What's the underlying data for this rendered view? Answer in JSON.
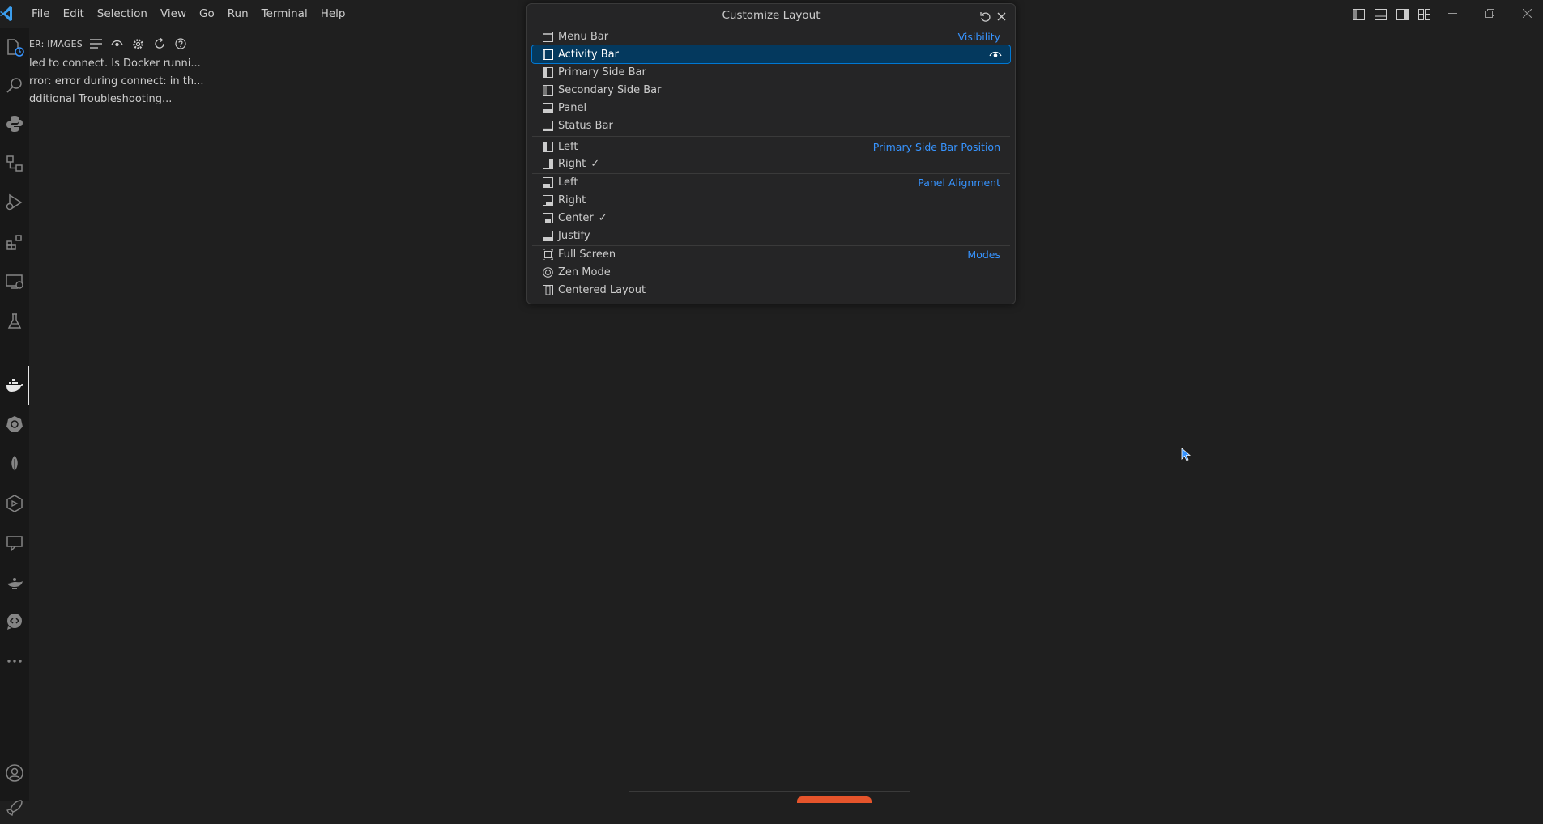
{
  "menu": [
    "File",
    "Edit",
    "Selection",
    "View",
    "Go",
    "Run",
    "Terminal",
    "Help"
  ],
  "sidebar": {
    "title": "ER: IMAGES",
    "lines": [
      "led to connect. Is Docker runni...",
      "rror: error during connect: in th...",
      "dditional Troubleshooting..."
    ]
  },
  "quickpick": {
    "title": "Customize Layout",
    "groups": {
      "visibility": "Visibility",
      "sidebar_position": "Primary Side Bar Position",
      "panel_alignment": "Panel Alignment",
      "modes": "Modes"
    },
    "items": [
      {
        "label": "Menu Bar",
        "checked": ""
      },
      {
        "label": "Activity Bar",
        "checked": ""
      },
      {
        "label": "Primary Side Bar",
        "checked": ""
      },
      {
        "label": "Secondary Side Bar",
        "checked": ""
      },
      {
        "label": "Panel",
        "checked": ""
      },
      {
        "label": "Status Bar",
        "checked": ""
      },
      {
        "label": "Left",
        "checked": ""
      },
      {
        "label": "Right",
        "checked": "✓"
      },
      {
        "label": "Left",
        "checked": ""
      },
      {
        "label": "Right",
        "checked": ""
      },
      {
        "label": "Center",
        "checked": "✓"
      },
      {
        "label": "Justify",
        "checked": ""
      },
      {
        "label": "Full Screen",
        "checked": ""
      },
      {
        "label": "Zen Mode",
        "checked": ""
      },
      {
        "label": "Centered Layout",
        "checked": ""
      }
    ]
  },
  "colors": {
    "accent": "#0078d4",
    "selection": "#04395e",
    "group_label": "#3794ff",
    "background": "#1f1f1f"
  }
}
